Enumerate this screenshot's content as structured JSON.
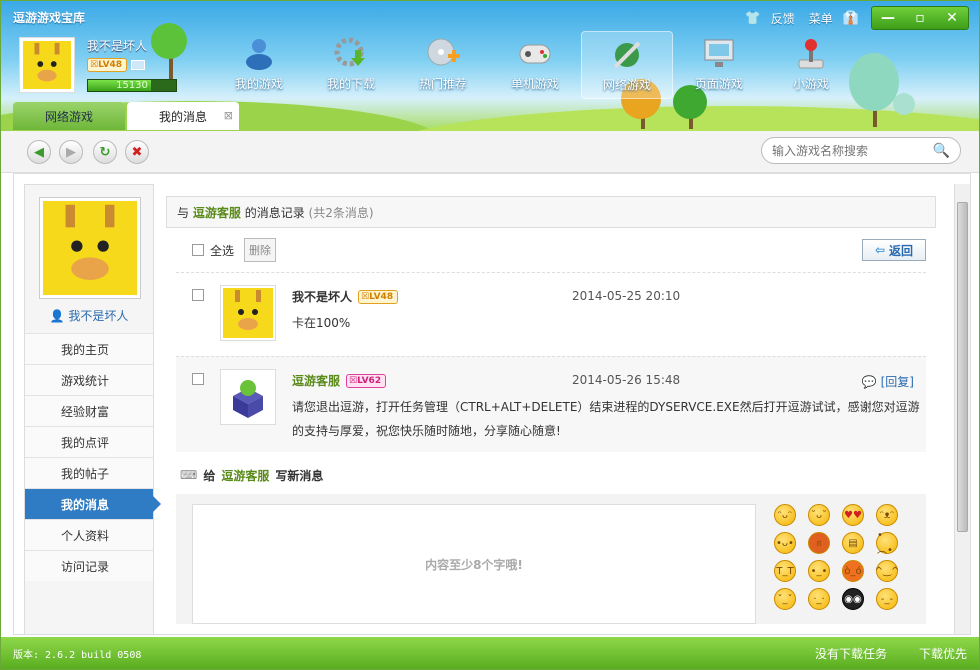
{
  "app": {
    "title": "逗游游戏宝库",
    "feedback": "反馈",
    "menu": "菜单"
  },
  "user": {
    "name": "我不是坏人",
    "level": "LV48",
    "exp": "15130",
    "exp_fraction": 0.72
  },
  "nav": [
    {
      "label": "我的游戏",
      "icon": "user-group-icon"
    },
    {
      "label": "我的下载",
      "icon": "download-gear-icon"
    },
    {
      "label": "热门推荐",
      "icon": "disc-plus-icon"
    },
    {
      "label": "单机游戏",
      "icon": "gamepad-icon"
    },
    {
      "label": "网络游戏",
      "icon": "sword-globe-icon"
    },
    {
      "label": "页面游戏",
      "icon": "monitor-icon"
    },
    {
      "label": "小游戏",
      "icon": "joystick-icon"
    }
  ],
  "tabs": [
    {
      "label": "网络游戏"
    },
    {
      "label": "我的消息"
    }
  ],
  "search": {
    "placeholder": "输入游戏名称搜索"
  },
  "sidebar": {
    "name": "我不是坏人",
    "items": [
      {
        "label": "我的主页"
      },
      {
        "label": "游戏统计"
      },
      {
        "label": "经验财富"
      },
      {
        "label": "我的点评"
      },
      {
        "label": "我的帖子"
      },
      {
        "label": "我的消息"
      },
      {
        "label": "个人资料"
      },
      {
        "label": "访问记录"
      }
    ],
    "active_index": 5
  },
  "messages_header": {
    "prefix": "与",
    "partner": "逗游客服",
    "suffix": "的消息记录",
    "count": "(共2条消息)"
  },
  "actions": {
    "select_all": "全选",
    "delete": "删除",
    "back": "返回"
  },
  "messages": [
    {
      "name": "我不是坏人",
      "level": "LV48",
      "time": "2014-05-25 20:10",
      "text": "卡在100%"
    },
    {
      "name": "逗游客服",
      "level": "LV62",
      "time": "2014-05-26 15:48",
      "reply": "[回复]",
      "text": "请您退出逗游，打开任务管理（CTRL+ALT+DELETE）结束进程的DYSERVCE.EXE然后打开逗游试试，感谢您对逗游的支持与厚爱，祝您快乐随时随地，分享随心随意!"
    }
  ],
  "compose": {
    "prefix": "给",
    "partner": "逗游客服",
    "suffix": "写新消息",
    "placeholder": "内容至少8个字哦!"
  },
  "status": {
    "version": "版本: 2.6.2 build 0508",
    "no_task": "没有下载任务",
    "priority": "下载优先"
  }
}
